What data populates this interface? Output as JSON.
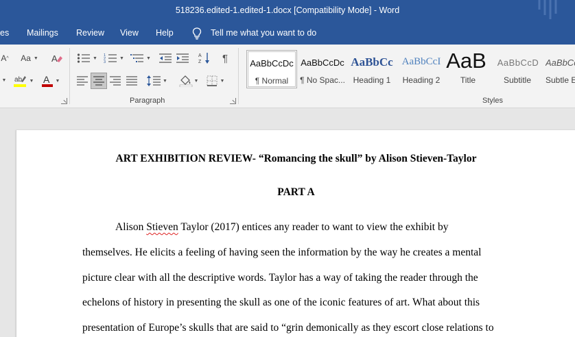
{
  "window": {
    "title": "518236.edited-1.edited-1.docx  [Compatibility Mode]  -  Word"
  },
  "tabs": [
    "es",
    "Mailings",
    "Review",
    "View",
    "Help"
  ],
  "tell_me": "Tell me what you want to do",
  "ribbon": {
    "font": {
      "grow_label": "A",
      "change_case_label": "Aa"
    },
    "paragraph_label": "Paragraph",
    "styles_label": "Styles",
    "styles": [
      {
        "sample": "AaBbCcDc",
        "name": "¶ Normal"
      },
      {
        "sample": "AaBbCcDc",
        "name": "¶ No Spac..."
      },
      {
        "sample": "AaBbCc",
        "name": "Heading 1"
      },
      {
        "sample": "AaBbCcI",
        "name": "Heading 2"
      },
      {
        "sample": "AaB",
        "name": "Title"
      },
      {
        "sample": "AaBbCcD",
        "name": "Subtitle"
      },
      {
        "sample": "AaBbCcD",
        "name": "Subtle E"
      }
    ],
    "colors": {
      "highlight": "#ffff00",
      "font_color": "#c00000"
    }
  },
  "document": {
    "heading": "ART EXHIBITION REVIEW- “Romancing the skull” by Alison Stieven-Taylor",
    "part": "PART A",
    "para_first": {
      "pre": "Alison ",
      "misspelled": "Stieven",
      "post": " Taylor (2017) entices any reader to want to view the exhibit by"
    },
    "lines": [
      "themselves. He elicits a feeling of having seen the information by the way he creates a mental",
      "picture clear with all the descriptive words. Taylor has a way of taking the reader through the",
      "echelons of history in presenting the skull as one of the iconic features of art. What about this",
      "presentation of Europe’s skulls that are said to “grin demonically as they escort close relations to"
    ]
  }
}
